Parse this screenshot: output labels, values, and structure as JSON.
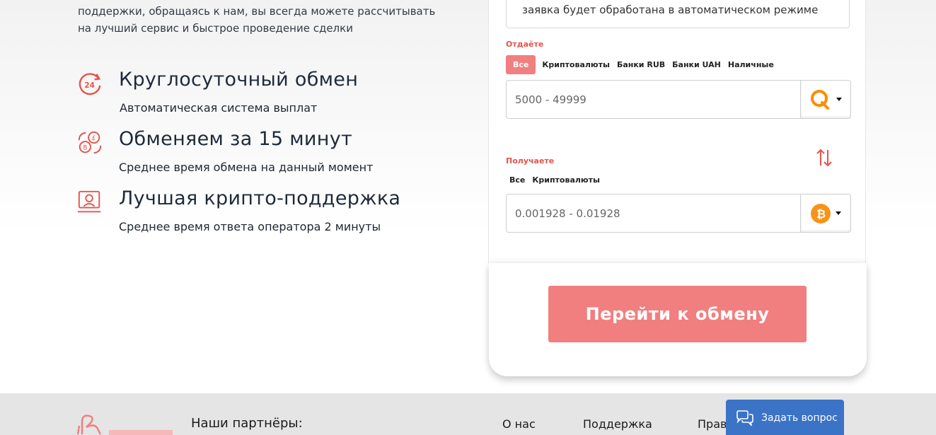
{
  "intro": {
    "line1": "поддержки, обращаясь к нам, вы всегда можете рассчитывать",
    "line2": "на лучший сервис и быстрое проведение сделки"
  },
  "features": [
    {
      "icon": "clock-24-icon",
      "title": "Круглосуточный обмен",
      "subtitle": "Автоматическая система выплат"
    },
    {
      "icon": "currency-exchange-icon",
      "title": "Обменяем за 15 минут",
      "subtitle": "Среднее время обмена на данный момент"
    },
    {
      "icon": "support-operator-icon",
      "title": "Лучшая крипто-поддержка",
      "subtitle": "Среднее время ответа оператора 2 минуты"
    }
  ],
  "form": {
    "notice": "заявка будет обработана в автоматическом режиме",
    "give": {
      "label": "Отдаёте",
      "tabs": [
        "Все",
        "Криптовалюты",
        "Банки RUB",
        "Банки UAH",
        "Наличные"
      ],
      "active_tab": "Все",
      "placeholder": "5000 - 49999",
      "currency_icon": "qiwi-icon"
    },
    "get": {
      "label": "Получаете",
      "tabs": [
        "Все",
        "Криптовалюты"
      ],
      "placeholder": "0.001928 - 0.01928",
      "currency_icon": "bitcoin-icon"
    },
    "submit_label": "Перейти к обмену"
  },
  "footer": {
    "partners_title": "Наши партнёры:",
    "links": [
      "О нас",
      "Поддержка",
      "Прав"
    ]
  },
  "chat": {
    "label": "Задать вопрос"
  },
  "colors": {
    "accent": "#f17f7f",
    "label_red": "#e5534b",
    "chat_blue": "#3b73c6",
    "bitcoin": "#f7931a",
    "qiwi": "#ff8c00"
  }
}
